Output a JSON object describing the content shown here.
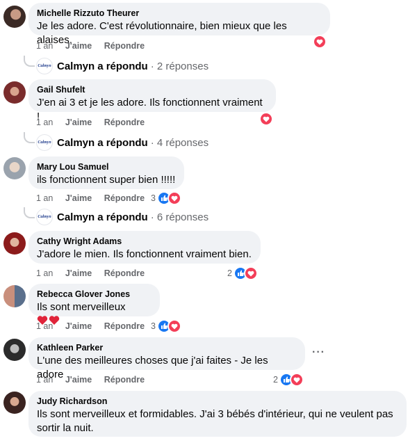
{
  "comments": [
    {
      "author": "Michelle Rizzuto Theurer",
      "text": "Je les adore. C'est révolutionnaire, bien mieux que les alaises.",
      "time": "1 an",
      "like": "J'aime",
      "reply": "Répondre",
      "reaction_count": "",
      "replies": {
        "author": "Calmyn",
        "action": "a répondu",
        "count": "· 2 réponses"
      }
    },
    {
      "author": "Gail Shufelt",
      "text": "J'en ai 3 et je les adore. Ils fonctionnent vraiment !",
      "time": "1 an",
      "like": "J'aime",
      "reply": "Répondre",
      "reaction_count": "",
      "replies": {
        "author": "Calmyn",
        "action": "a répondu",
        "count": "· 4 réponses"
      }
    },
    {
      "author": "Mary Lou Samuel",
      "text": "ils fonctionnent super bien !!!!!",
      "time": "1 an",
      "like": "J'aime",
      "reply": "Répondre",
      "reaction_count": "3",
      "replies": {
        "author": "Calmyn",
        "action": "a répondu",
        "count": "· 6 réponses"
      }
    },
    {
      "author": "Cathy Wright Adams",
      "text": "J'adore le mien. Ils fonctionnent vraiment bien.",
      "time": "1 an",
      "like": "J'aime",
      "reply": "Répondre",
      "reaction_count": "2"
    },
    {
      "author": "Rebecca Glover Jones",
      "text": "Ils sont merveilleux",
      "time": "1 an",
      "like": "J'aime",
      "reply": "Répondre",
      "reaction_count": "3"
    },
    {
      "author": "Kathleen Parker",
      "text": "L'une des meilleures choses que j'ai faites - Je les adore",
      "time": "1 an",
      "like": "J'aime",
      "reply": "Répondre",
      "reaction_count": "2"
    },
    {
      "author": "Judy Richardson",
      "text_line1": "Ils sont merveilleux et formidables. J'ai 3 bébés d'intérieur, qui ne veulent pas",
      "text_line2": "sortir la nuit."
    }
  ],
  "brand_avatar_text": "Calmyn",
  "more_options": "···",
  "icons": [
    "love-reaction-icon",
    "like-reaction-icon",
    "heart-emoji-icon"
  ],
  "colors": {
    "bubble": "#f0f2f5",
    "like": "#1877f2",
    "love": "#f33e58",
    "meta": "#65676b"
  }
}
